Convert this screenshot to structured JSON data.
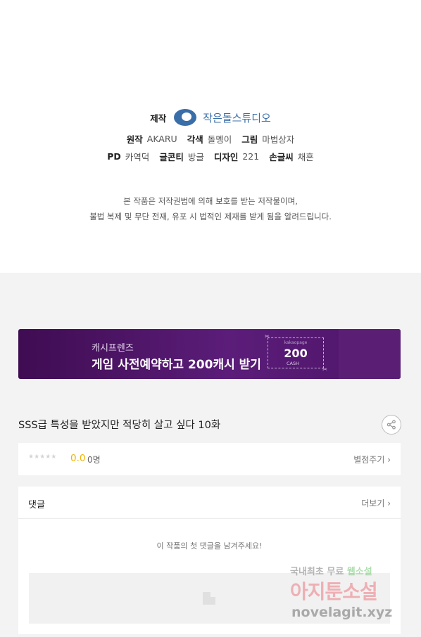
{
  "credits": {
    "studio_label": "제작",
    "studio_name": "작은돌스튜디오",
    "row1": [
      {
        "label": "원작",
        "value": "AKARU"
      },
      {
        "label": "각색",
        "value": "돌멩이"
      },
      {
        "label": "그림",
        "value": "마법상자"
      }
    ],
    "row2": [
      {
        "label": "PD",
        "value": "카역덕"
      },
      {
        "label": "글콘티",
        "value": "방글"
      },
      {
        "label": "디자인",
        "value": "221"
      },
      {
        "label": "손글씨",
        "value": "채흔"
      }
    ],
    "notice_line1": "본 작품은 저작권법에 의해 보호를 받는 저작물이며,",
    "notice_line2": "불법 복제 및 무단 전재, 유포 시 법적인 제재를 받게 됨을 알려드립니다."
  },
  "banner": {
    "subtitle": "캐시프렌즈",
    "title": "게임 사전예약하고 200캐시 받기",
    "coupon_top": "kakaopage",
    "coupon_amount": "200",
    "coupon_unit": "CASH"
  },
  "episode": {
    "title": "SSS급 특성을 받았지만 적당히 살고 싶다 10화"
  },
  "rating": {
    "stars": "★★★★★",
    "score": "0.0",
    "count": "0명",
    "rate_link": "별점주기 ›"
  },
  "comments": {
    "label": "댓글",
    "more_link": "더보기 ›",
    "empty_message": "이 작품의 첫 댓글을 남겨주세요!"
  },
  "watermark": {
    "line1_a": "국내최초 무료",
    "line1_b": "웹소설",
    "line2": "아지툰소설",
    "line3": "novelagit.xyz"
  },
  "colors": {
    "banner_bg": "#4e1469",
    "studio_blue": "#3a6ea8",
    "score_yellow": "#f0b400",
    "page_gray": "#f3f3f3"
  }
}
